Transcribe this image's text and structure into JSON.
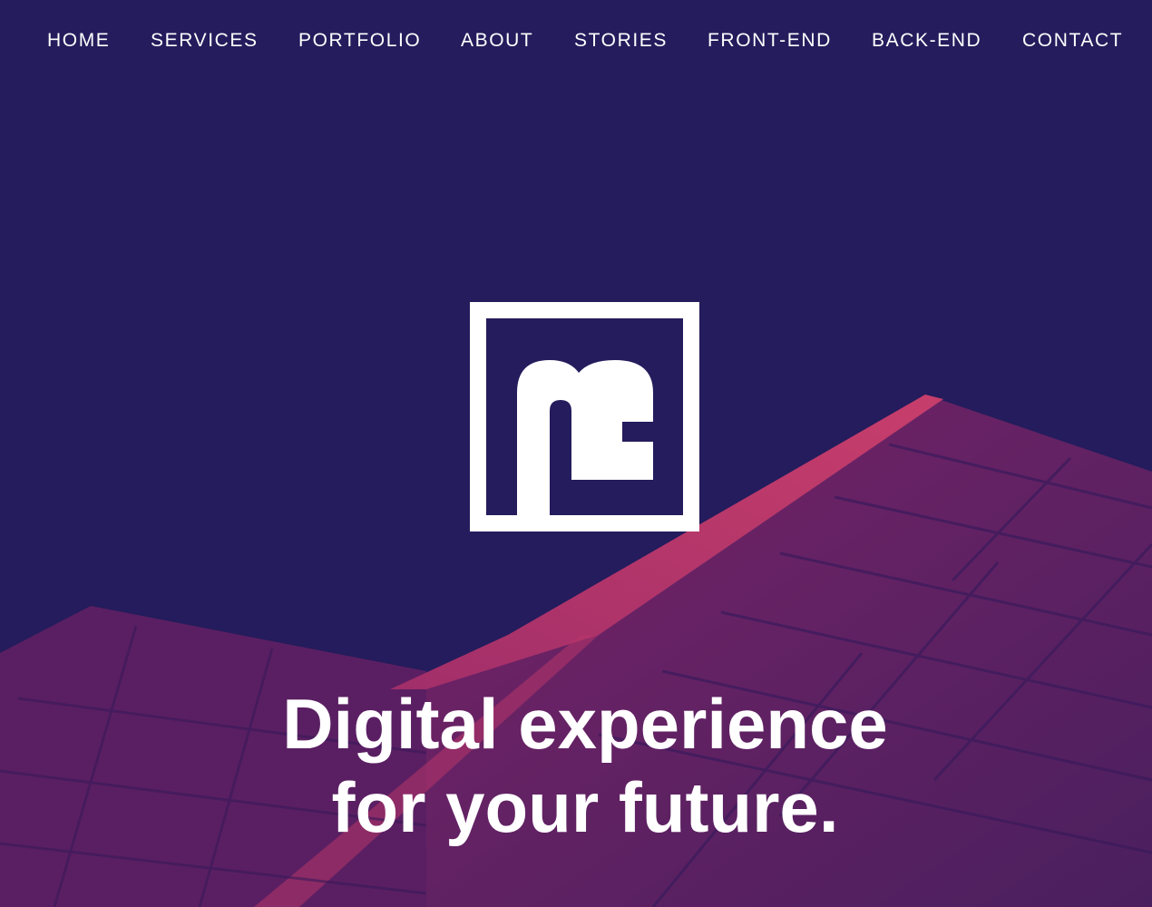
{
  "nav": {
    "items": [
      {
        "label": "HOME"
      },
      {
        "label": "SERVICES"
      },
      {
        "label": "PORTFOLIO"
      },
      {
        "label": "ABOUT"
      },
      {
        "label": "STORIES"
      },
      {
        "label": "FRONT-END"
      },
      {
        "label": "BACK-END"
      },
      {
        "label": "CONTACT"
      }
    ]
  },
  "hero": {
    "logo_icon": "m-monogram-logo",
    "headline_line1": "Digital experience",
    "headline_line2": "for your future."
  },
  "colors": {
    "background": "#241c5c",
    "building": "#6a2266",
    "building_highlight": "#c23a6a",
    "text": "#ffffff"
  }
}
